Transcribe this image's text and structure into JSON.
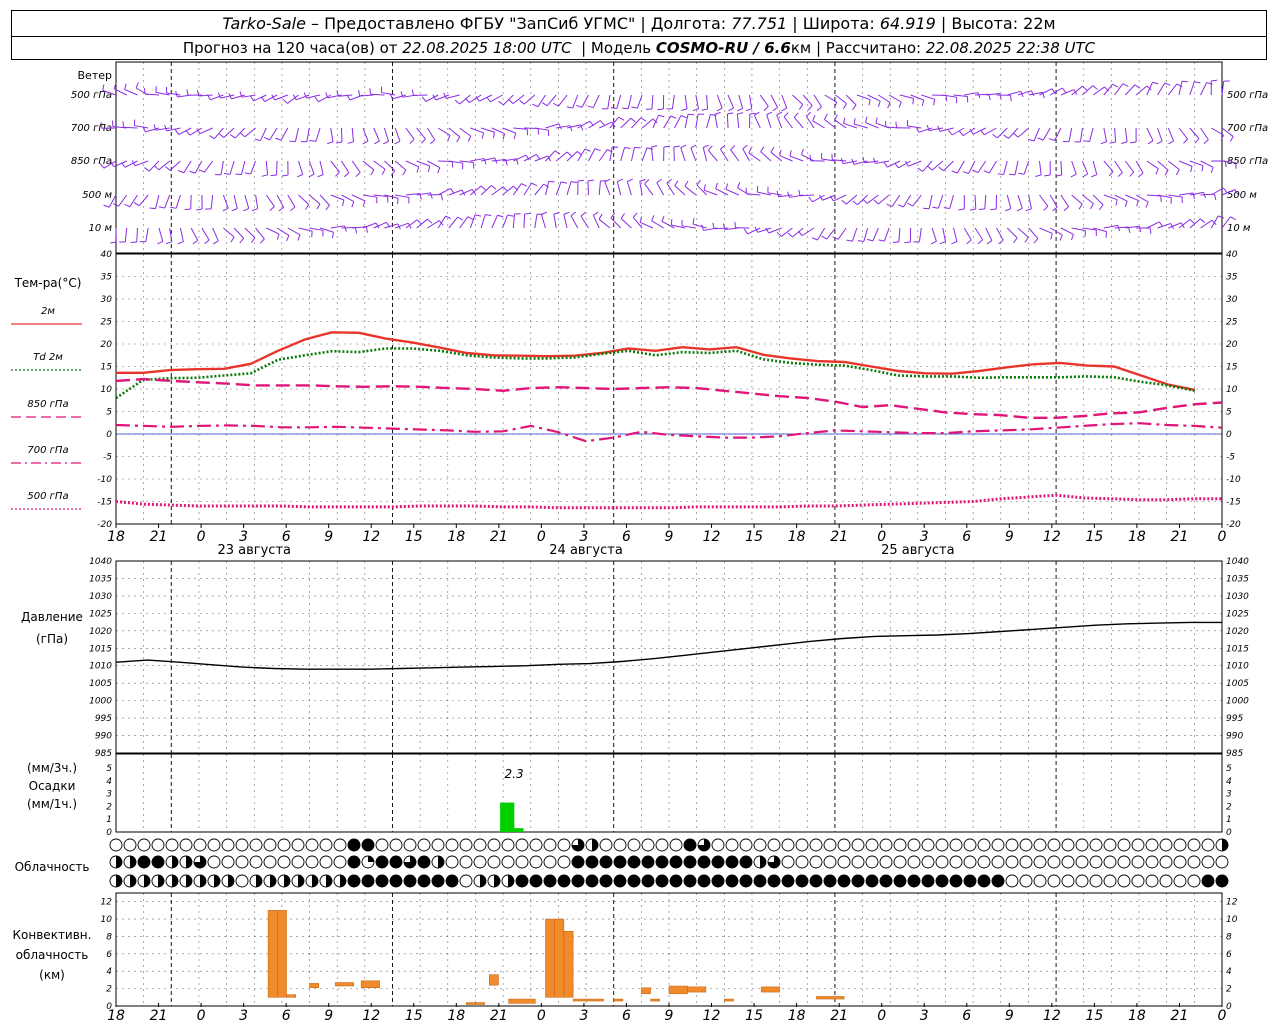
{
  "header": {
    "station": "Tarko-Sale",
    "dash": " – Предоставлено ФГБУ \"ЗапСиб УГМС\" | Долгота: ",
    "lon": "77.751",
    "lat_label": " | Широта: ",
    "lat": "64.919",
    "alt_label": " | Высота: 22м",
    "forecast_label": "Прогноз на 120 часа(ов) от ",
    "forecast_time": "22.08.2025 18:00 UTC",
    "model_label": "  | Модель ",
    "model": "COSMO-RU / 6.6",
    "model_unit": "км",
    "calc_label": " | Рассчитано: ",
    "calc_time": "22.08.2025 22:38 UTC"
  },
  "wind_panel": {
    "title": "Ветер",
    "levels": [
      "500 гПа",
      "700 гПа",
      "850 гПа",
      "500 м",
      "10  м"
    ]
  },
  "temp_panel": {
    "title": "Тем-ра(°C)",
    "legend": [
      {
        "label": "2м",
        "color": "#e8352b",
        "style": "solid"
      },
      {
        "label": "Td  2м",
        "color": "#0a7a0a",
        "style": "dotted"
      },
      {
        "label": "850 гПа",
        "color": "#e0157a",
        "style": "dash"
      },
      {
        "label": "700 гПа",
        "color": "#e0157a",
        "style": "dashdot"
      },
      {
        "label": "500 гПа",
        "color": "#e0157a",
        "style": "dotted"
      }
    ]
  },
  "pressure_panel": {
    "title": "Давление",
    "unit": "(гПа)"
  },
  "precip_panel": {
    "unit3": "(мм/3ч.)",
    "title": "Осадки",
    "unit1": "(мм/1ч.)",
    "max_label": "2.3"
  },
  "cloud_panel": {
    "title": "Облачность"
  },
  "conv_panel": {
    "title1": "Конвективн.",
    "title2": "облачность",
    "unit": "(км)"
  },
  "x_axis": {
    "hour_labels": [
      "18",
      "21",
      "0",
      "3",
      "6",
      "9",
      "12",
      "15",
      "18",
      "21",
      "0",
      "3",
      "6",
      "9",
      "12",
      "15",
      "18",
      "21",
      "0",
      "3",
      "6",
      "9",
      "12",
      "15",
      "18",
      "21",
      "0"
    ],
    "days": [
      "23 августа",
      "24 августа",
      "25 августа"
    ]
  },
  "colors": {
    "wind": "#8a2be2",
    "t2m": "#e8352b",
    "td2m": "#0a7a0a",
    "upper": "#e0157a",
    "precip": "#00d000",
    "conv": "#f08a2a"
  },
  "chart_data": [
    {
      "type": "line",
      "title": "Тем-ра(°C)",
      "ylim": [
        -20,
        40
      ],
      "x_hours_from_start": [
        0,
        3,
        6,
        9,
        12,
        15,
        18,
        21,
        24,
        27,
        30,
        33,
        36,
        39,
        42,
        45,
        48,
        51,
        54,
        57,
        60,
        63,
        66,
        69,
        72,
        75,
        78,
        81,
        84,
        87,
        90,
        93,
        96,
        99,
        102,
        105,
        108,
        111,
        114,
        117,
        120
      ],
      "series": [
        {
          "name": "2м",
          "values": [
            13.6,
            13.6,
            14.2,
            14.4,
            14.5,
            15.6,
            18.5,
            21,
            22.6,
            22.5,
            21.2,
            20.3,
            19.2,
            18,
            17.5,
            17.4,
            17.3,
            17.4,
            18,
            19,
            18.5,
            19.3,
            18.8,
            19.3,
            17.6,
            16.8,
            16.2,
            16,
            15,
            14,
            13.5,
            13.4,
            14,
            14.8,
            15.5,
            15.8,
            15.2,
            15,
            13,
            11,
            9.8,
            7.4
          ]
        },
        {
          "name": "Td  2м",
          "values": [
            8,
            12,
            12.4,
            12.5,
            13,
            13.5,
            16.5,
            17.5,
            18.4,
            18.2,
            19,
            19,
            18.5,
            17.5,
            17,
            16.8,
            16.8,
            17,
            17.8,
            18.5,
            17.5,
            18.2,
            18,
            18.5,
            16.6,
            15.8,
            15.4,
            15.2,
            14.2,
            13,
            12.8,
            12.8,
            12.5,
            12.6,
            12.6,
            12.6,
            12.8,
            12.6,
            11.6,
            10.8,
            9.6,
            7.5
          ]
        },
        {
          "name": "850 гПа",
          "values": [
            11.8,
            12.2,
            11.8,
            11.5,
            11.2,
            10.8,
            10.8,
            10.8,
            10.6,
            10.5,
            10.6,
            10.5,
            10.2,
            10,
            9.6,
            10.2,
            10.4,
            10.2,
            10,
            10.2,
            10.4,
            10.2,
            9.6,
            9,
            8.4,
            8,
            7.2,
            6,
            6.4,
            5.6,
            4.8,
            4.4,
            4.2,
            3.6,
            3.6,
            4,
            4.6,
            4.8,
            5.8,
            6.6,
            7
          ]
        },
        {
          "name": "700 гПа",
          "values": [
            2,
            1.8,
            1.6,
            1.8,
            1.9,
            1.8,
            1.5,
            1.5,
            1.6,
            1.4,
            1.2,
            1,
            0.8,
            0.5,
            0.6,
            1.8,
            0.4,
            -1.6,
            -0.8,
            0.5,
            -0.2,
            -0.5,
            -0.8,
            -0.8,
            -0.5,
            0.2,
            0.8,
            0.6,
            0.4,
            0.2,
            0.2,
            0.6,
            0.8,
            1,
            1.4,
            1.8,
            2.2,
            2.4,
            2,
            1.8,
            1.4
          ]
        },
        {
          "name": "500 гПа",
          "values": [
            -15,
            -15.6,
            -15.8,
            -16,
            -16,
            -16,
            -16,
            -16.2,
            -16.2,
            -16.2,
            -16.2,
            -16,
            -16,
            -16,
            -16.2,
            -16.2,
            -16.4,
            -16.4,
            -16.4,
            -16.4,
            -16.4,
            -16.2,
            -16.2,
            -16.2,
            -16.2,
            -16,
            -16,
            -15.8,
            -15.6,
            -15.4,
            -15.2,
            -15,
            -14.4,
            -14,
            -13.6,
            -14.2,
            -14.4,
            -14.6,
            -14.6,
            -14.4,
            -14.4
          ]
        }
      ]
    },
    {
      "type": "line",
      "title": "Давление",
      "ylabel": "(гПа)",
      "ylim": [
        985,
        1040
      ],
      "x_hours_from_start": [
        0,
        3,
        6,
        9,
        12,
        15,
        18,
        21,
        24,
        27,
        30,
        33,
        36,
        39,
        42,
        45,
        48,
        51,
        54,
        57,
        60,
        63,
        66,
        69,
        72,
        75,
        78,
        81,
        84,
        87,
        90,
        93,
        96,
        99,
        102,
        105,
        108,
        111,
        114,
        117,
        120
      ],
      "series": [
        {
          "name": "",
          "values": [
            1011,
            1011.6,
            1011,
            1010.3,
            1009.6,
            1009.2,
            1009,
            1009,
            1009,
            1009.2,
            1009.4,
            1009.6,
            1009.8,
            1010,
            1010.4,
            1010.6,
            1011.2,
            1012,
            1013,
            1014,
            1015,
            1016,
            1017,
            1017.8,
            1018.4,
            1018.6,
            1018.8,
            1019.2,
            1019.8,
            1020.4,
            1021,
            1021.6,
            1022,
            1022.2,
            1022.4,
            1022.4
          ]
        }
      ]
    },
    {
      "type": "bar",
      "title": "Осадки",
      "ylabel": "(мм/1ч.)",
      "ylim": [
        0,
        5
      ],
      "bars": [
        {
          "hour_from_start": 42,
          "value": 2.3
        },
        {
          "hour_from_start": 43,
          "value": 0.3
        }
      ],
      "annotation": "2.3"
    },
    {
      "type": "bar",
      "title": "Конвективн. облачность",
      "ylabel": "(км)",
      "ylim": [
        0,
        13
      ],
      "ranges_km": [
        {
          "h0": 16.5,
          "h1": 17.5,
          "base": 1,
          "top": 11
        },
        {
          "h0": 17.5,
          "h1": 18.5,
          "base": 1,
          "top": 11
        },
        {
          "h0": 18.5,
          "h1": 19.5,
          "base": 1,
          "top": 1.3
        },
        {
          "h0": 21,
          "h1": 22,
          "base": 2.1,
          "top": 2.6
        },
        {
          "h0": 23.8,
          "h1": 25.8,
          "base": 2.3,
          "top": 2.7
        },
        {
          "h0": 26.6,
          "h1": 28.6,
          "base": 2.1,
          "top": 2.9
        },
        {
          "h0": 38,
          "h1": 39,
          "base": 0.3,
          "top": 0.4
        },
        {
          "h0": 39,
          "h1": 40,
          "base": 0.3,
          "top": 0.4
        },
        {
          "h0": 40.5,
          "h1": 41.5,
          "base": 2.4,
          "top": 3.6
        },
        {
          "h0": 42.6,
          "h1": 45.5,
          "base": 0.3,
          "top": 0.8
        },
        {
          "h0": 46.6,
          "h1": 47.6,
          "base": 1,
          "top": 10
        },
        {
          "h0": 47.6,
          "h1": 48.6,
          "base": 1,
          "top": 10
        },
        {
          "h0": 48.6,
          "h1": 49.6,
          "base": 1,
          "top": 8.6
        },
        {
          "h0": 49.6,
          "h1": 52.9,
          "base": 0.6,
          "top": 0.8
        },
        {
          "h0": 54,
          "h1": 55,
          "base": 0.6,
          "top": 0.8
        },
        {
          "h0": 57,
          "h1": 58,
          "base": 1.4,
          "top": 2.1
        },
        {
          "h0": 58,
          "h1": 59,
          "base": 0.6,
          "top": 0.8
        },
        {
          "h0": 60,
          "h1": 62,
          "base": 1.4,
          "top": 2.3
        },
        {
          "h0": 62,
          "h1": 64,
          "base": 1.6,
          "top": 2.2
        },
        {
          "h0": 66,
          "h1": 67,
          "base": 0.6,
          "top": 0.8
        },
        {
          "h0": 70,
          "h1": 72,
          "base": 1.6,
          "top": 2.2
        },
        {
          "h0": 76,
          "h1": 79,
          "base": 0.8,
          "top": 1.1
        }
      ]
    }
  ]
}
